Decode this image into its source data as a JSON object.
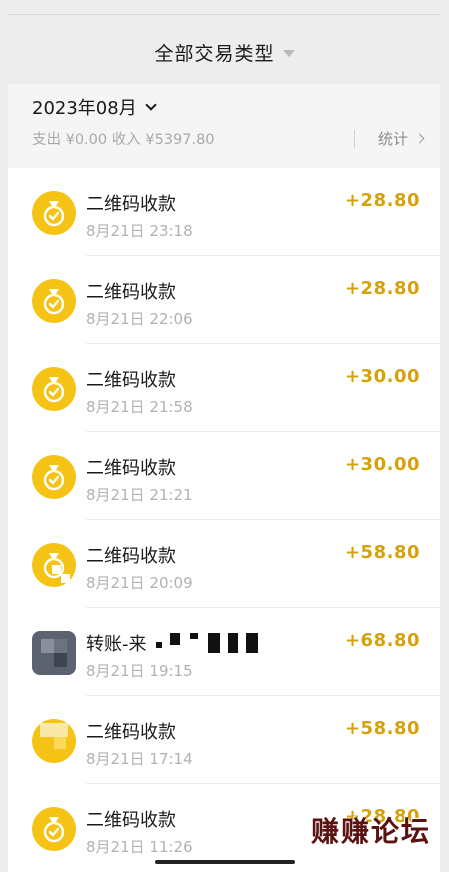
{
  "filter": {
    "label": "全部交易类型"
  },
  "summary": {
    "month": "2023年08月",
    "totals": "支出 ¥0.00 收入 ¥5397.80",
    "stats_label": "统计"
  },
  "colors": {
    "accent": "#f4c316",
    "amount": "#d6a20a"
  },
  "transactions": [
    {
      "title": "二维码收款",
      "time": "8月21日 23:18",
      "amount": "+28.80",
      "icon": "money-bag-icon"
    },
    {
      "title": "二维码收款",
      "time": "8月21日 22:06",
      "amount": "+28.80",
      "icon": "money-bag-icon"
    },
    {
      "title": "二维码收款",
      "time": "8月21日 21:58",
      "amount": "+30.00",
      "icon": "money-bag-icon"
    },
    {
      "title": "二维码收款",
      "time": "8月21日 21:21",
      "amount": "+30.00",
      "icon": "money-bag-icon"
    },
    {
      "title": "二维码收款",
      "time": "8月21日 20:09",
      "amount": "+58.80",
      "icon": "money-bag-icon"
    },
    {
      "title": "转账-来",
      "time": "8月21日 19:15",
      "amount": "+68.80",
      "icon": "user-avatar"
    },
    {
      "title": "二维码收款",
      "time": "8月21日 17:14",
      "amount": "+58.80",
      "icon": "money-bag-icon"
    },
    {
      "title": "二维码收款",
      "time": "8月21日 11:26",
      "amount": "+28.80",
      "icon": "money-bag-icon"
    }
  ],
  "watermark": "赚赚论坛"
}
